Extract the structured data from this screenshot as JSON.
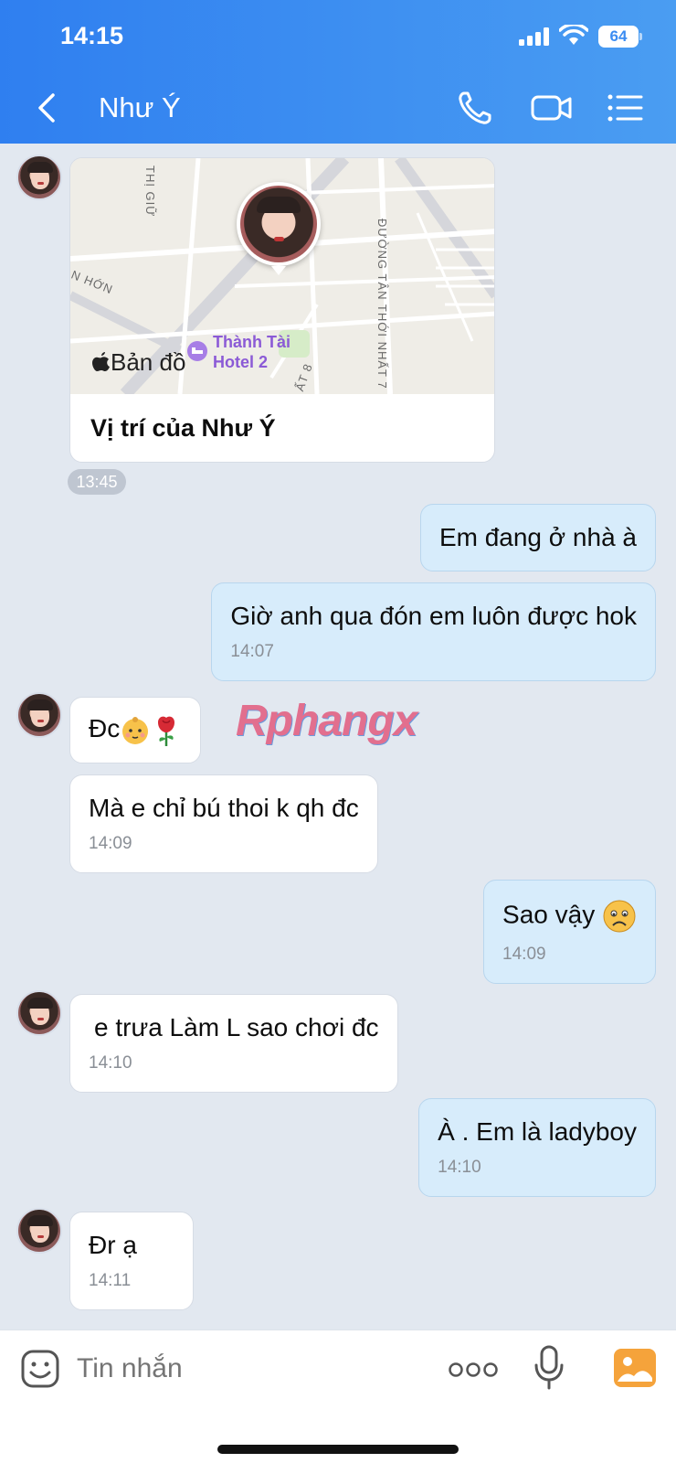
{
  "status": {
    "time": "14:15",
    "battery": "64"
  },
  "header": {
    "title": "Như Ý"
  },
  "location_card": {
    "title": "Vị trí của Như Ý",
    "map_brand": "Bản đồ",
    "map_poi": "Thành Tài Hotel 2",
    "street_labels": [
      "THỊ GIỮ",
      "N HỚN",
      "ĐƯỜNG TÂN THỚI NHẤT 7",
      "ẤT 8"
    ]
  },
  "watermark": "Rphangx",
  "messages": [
    {
      "side": "in",
      "text": "",
      "time": "13:45"
    },
    {
      "side": "out",
      "text": "Em đang ở nhà à",
      "time": ""
    },
    {
      "side": "out",
      "text": "Giờ anh qua đón em luôn được hok",
      "time": "14:07"
    },
    {
      "side": "in",
      "text": "Đc",
      "emoji": [
        "baby-emoji",
        "rose-emoji"
      ],
      "time": ""
    },
    {
      "side": "in",
      "text": "Mà e chỉ bú thoi k qh đc",
      "time": "14:09"
    },
    {
      "side": "out",
      "text": "Sao vậy",
      "emoji": [
        "frowning-face-emoji"
      ],
      "time": "14:09"
    },
    {
      "side": "in",
      "text": "e trưa Làm L sao chơi đc",
      "time": "14:10"
    },
    {
      "side": "out",
      "text": "À . Em là ladyboy",
      "time": "14:10"
    },
    {
      "side": "in",
      "text": "Đr ạ",
      "time": "14:11"
    }
  ],
  "input": {
    "placeholder": "Tin nhắn"
  },
  "colors": {
    "header_start": "#2f7ff0",
    "header_end": "#4a9df2",
    "outgoing_bubble": "#d7ecfb",
    "incoming_bubble": "#ffffff",
    "chat_bg": "#e2e8f0"
  }
}
